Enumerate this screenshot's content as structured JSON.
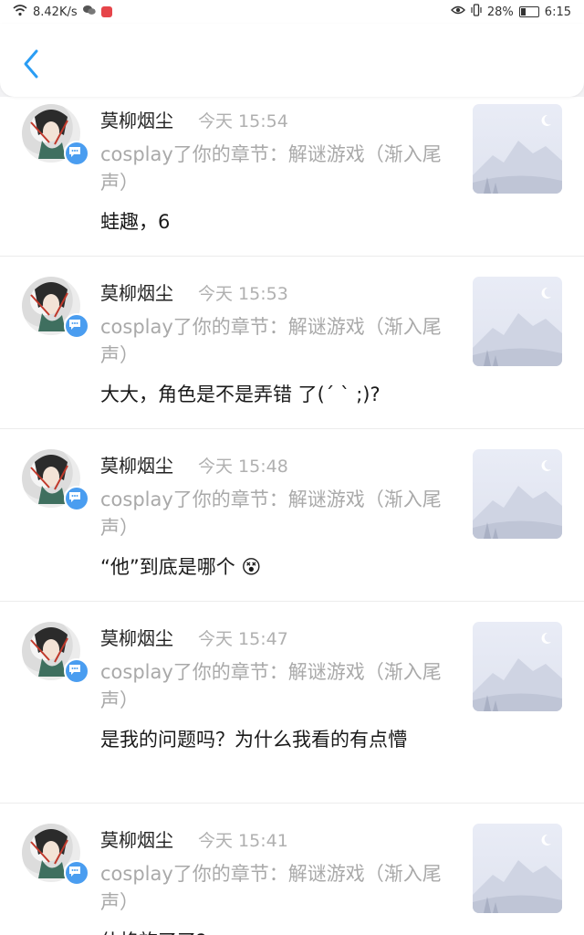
{
  "status_bar": {
    "network_speed": "8.42K/s",
    "battery_percent": "28%",
    "time": "6:15"
  },
  "notifications": [
    {
      "user": "莫柳烟尘",
      "time": "今天 15:54",
      "subtitle": "cosplay了你的章节：解谜游戏（渐入尾声）",
      "message": "蛙趣，6"
    },
    {
      "user": "莫柳烟尘",
      "time": "今天 15:53",
      "subtitle": "cosplay了你的章节：解谜游戏（渐入尾声）",
      "message": "大大，角色是不是弄错 了(´ ` ;)?"
    },
    {
      "user": "莫柳烟尘",
      "time": "今天 15:48",
      "subtitle": "cosplay了你的章节：解谜游戏（渐入尾声）",
      "message": "“他”到底是哪个 😵"
    },
    {
      "user": "莫柳烟尘",
      "time": "今天 15:47",
      "subtitle": "cosplay了你的章节：解谜游戏（渐入尾声）",
      "message": "是我的问题吗？为什么我看的有点懵"
    },
    {
      "user": "莫柳烟尘",
      "time": "今天 15:41",
      "subtitle": "cosplay了你的章节：解谜游戏（渐入尾声）",
      "message": "什格旅了了?"
    }
  ],
  "colors": {
    "accent": "#2a9df4",
    "badge": "#4a9df0",
    "muted_text": "#a9a9a9"
  }
}
